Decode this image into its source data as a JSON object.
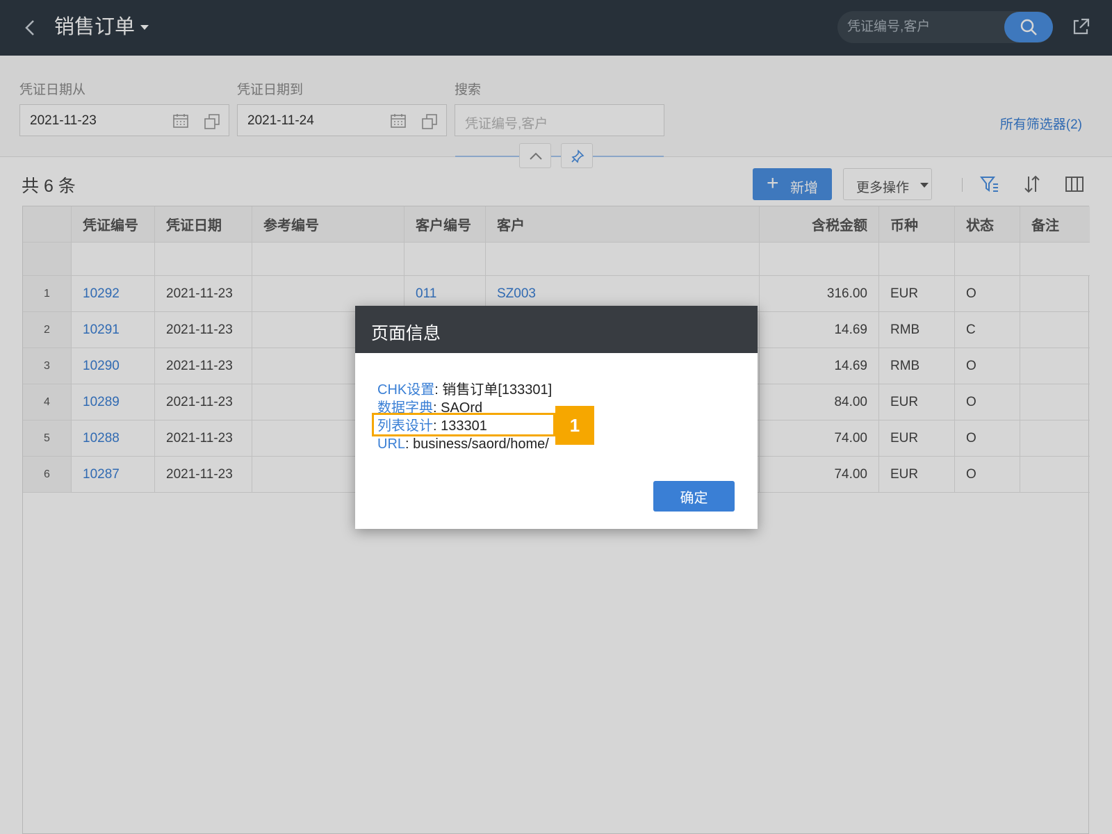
{
  "header": {
    "title": "销售订单",
    "search_placeholder": "凭证编号,客户"
  },
  "filters": {
    "date_from_label": "凭证日期从",
    "date_from_value": "2021-11-23",
    "date_to_label": "凭证日期到",
    "date_to_value": "2021-11-24",
    "search_label": "搜索",
    "search_placeholder": "凭证编号,客户",
    "all_filters": "所有筛选器(2)"
  },
  "toolbar": {
    "count": "共 6 条",
    "add_label": "新增",
    "more_label": "更多操作"
  },
  "table": {
    "columns": [
      "凭证编号",
      "凭证日期",
      "参考编号",
      "客户编号",
      "客户",
      "含税金额",
      "币种",
      "状态",
      "备注"
    ],
    "rows": [
      {
        "idx": "1",
        "no": "10292",
        "date": "2021-11-23",
        "ref": "",
        "cust_no": "011",
        "cust": "SZ003",
        "amount": "316.00",
        "currency": "EUR",
        "status": "O",
        "note": ""
      },
      {
        "idx": "2",
        "no": "10291",
        "date": "2021-11-23",
        "ref": "",
        "cust_no": "",
        "cust": "",
        "amount": "14.69",
        "currency": "RMB",
        "status": "C",
        "note": ""
      },
      {
        "idx": "3",
        "no": "10290",
        "date": "2021-11-23",
        "ref": "",
        "cust_no": "",
        "cust": "",
        "amount": "14.69",
        "currency": "RMB",
        "status": "O",
        "note": ""
      },
      {
        "idx": "4",
        "no": "10289",
        "date": "2021-11-23",
        "ref": "",
        "cust_no": "",
        "cust": "",
        "amount": "84.00",
        "currency": "EUR",
        "status": "O",
        "note": ""
      },
      {
        "idx": "5",
        "no": "10288",
        "date": "2021-11-23",
        "ref": "",
        "cust_no": "",
        "cust": "",
        "amount": "74.00",
        "currency": "EUR",
        "status": "O",
        "note": ""
      },
      {
        "idx": "6",
        "no": "10287",
        "date": "2021-11-23",
        "ref": "",
        "cust_no": "",
        "cust": "",
        "amount": "74.00",
        "currency": "EUR",
        "status": "O",
        "note": ""
      }
    ]
  },
  "modal": {
    "title": "页面信息",
    "lines": [
      {
        "key": "CHK设置",
        "value": "销售订单[133301]"
      },
      {
        "key": "数据字典",
        "value": "SAOrd"
      },
      {
        "key": "列表设计",
        "value": "133301"
      },
      {
        "key": "URL",
        "value": "business/saord/home/"
      }
    ],
    "ok_label": "确定"
  },
  "callout": {
    "number": "1",
    "color": "#f6a700"
  },
  "colors": {
    "primary": "#4a90e2",
    "header_bg": "#2f3a44",
    "link": "#3a7fd5",
    "closed_status": "#43a047"
  }
}
